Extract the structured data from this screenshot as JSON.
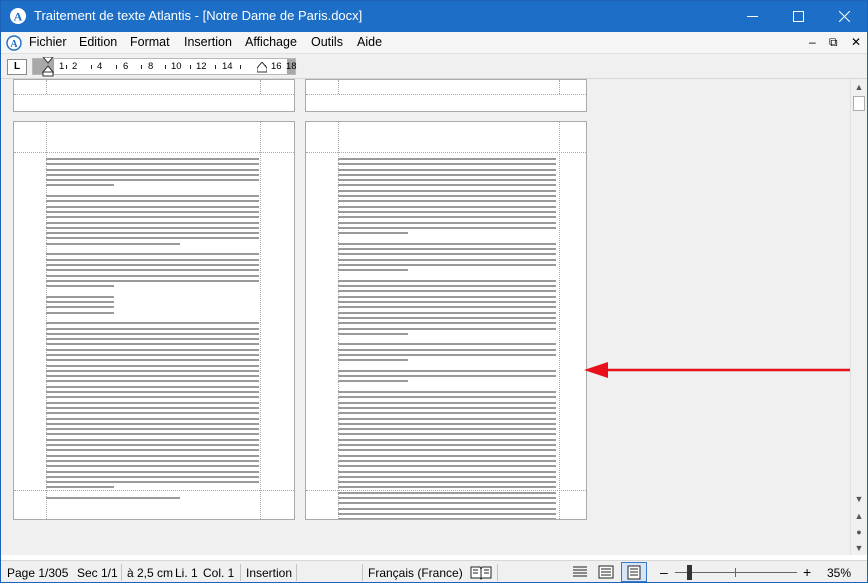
{
  "window": {
    "title": "Traitement de texte Atlantis - [Notre Dame de Paris.docx]"
  },
  "menu": {
    "items": [
      "Fichier",
      "Edition",
      "Format",
      "Insertion",
      "Affichage",
      "Outils",
      "Aide"
    ]
  },
  "ruler": {
    "tab_selector": "L",
    "numbers": [
      "1",
      "2",
      "4",
      "6",
      "8",
      "10",
      "12",
      "14",
      "16",
      "18"
    ]
  },
  "status": {
    "page": "Page 1/305",
    "section": "Sec 1/1",
    "position": "à 2,5 cm",
    "line": "Li. 1",
    "column": "Col. 1",
    "mode": "Insertion",
    "language": "Français (France)",
    "zoom_minus": "–",
    "zoom_plus": "+",
    "zoom": "35%"
  },
  "colors": {
    "titlebar": "#1c6ec6",
    "annotation_arrow": "#e8101a"
  },
  "icons": {
    "app": "atlantis-logo-icon",
    "minimize": "minimize-icon",
    "maximize": "maximize-icon",
    "close": "close-icon"
  }
}
